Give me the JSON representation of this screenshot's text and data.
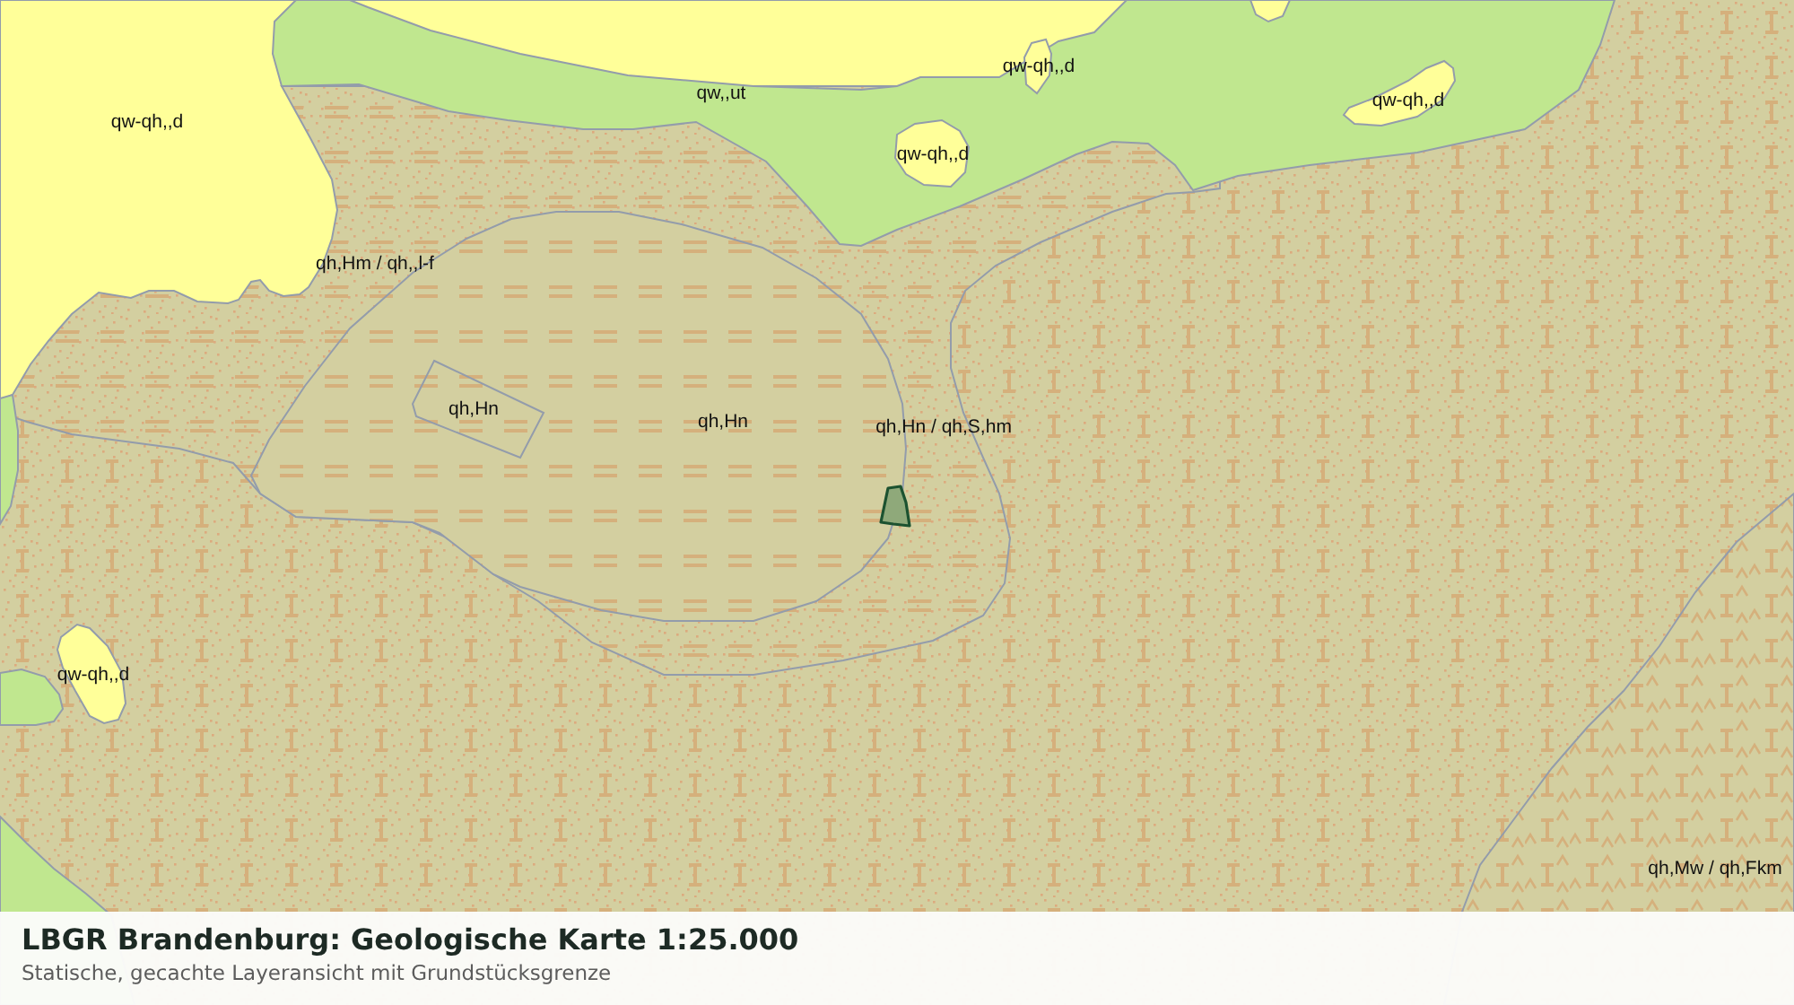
{
  "map": {
    "labels": [
      "qw-qh,,d",
      "qw,,ut",
      "qw-qh,,d",
      "qw-qh,,d",
      "qw-qh,,d",
      "qh,Hm / qh,,l-f",
      "qh,Hn",
      "qh,Hn",
      "qh,Hn / qh,S,hm",
      "qw-qh,,d",
      "qh,Mw / qh,Fkm"
    ]
  },
  "caption": {
    "title": "LBGR Brandenburg: Geologische Karte 1:25.000",
    "subtitle": "Statische, gecachte Layeransicht mit Grundstücksgrenze"
  }
}
